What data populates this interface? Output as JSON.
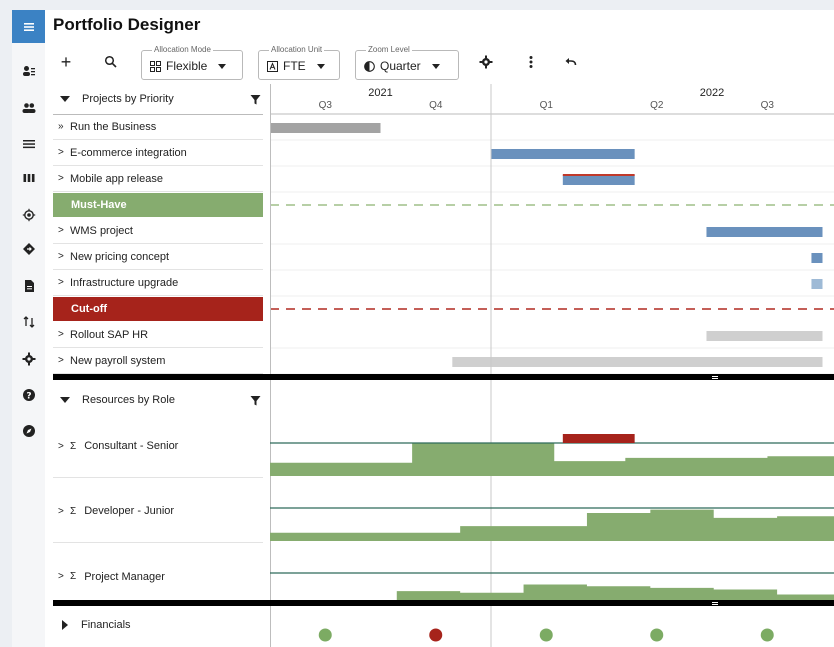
{
  "app": {
    "title": "Portfolio Designer"
  },
  "nav": {
    "icons": [
      "menu-icon",
      "person-list-icon",
      "people-icon",
      "list-icon",
      "columns-icon",
      "target-icon",
      "diamond-icon",
      "document-icon",
      "sort-icon",
      "gear-icon",
      "help-icon",
      "compass-icon"
    ]
  },
  "toolbar": {
    "add": "+",
    "search": "search-icon",
    "allocation_mode": {
      "legend": "Allocation Mode",
      "value": "Flexible"
    },
    "allocation_unit": {
      "legend": "Allocation Unit",
      "value": "FTE"
    },
    "zoom_level": {
      "legend": "Zoom Level",
      "value": "Quarter"
    }
  },
  "timeline": {
    "years": [
      "2021",
      "2022"
    ],
    "quarters": [
      "Q3",
      "Q4",
      "Q1",
      "Q2",
      "Q3"
    ]
  },
  "projects": {
    "header": "Projects by Priority",
    "items": [
      {
        "label": "Run the Business",
        "chevron": "»",
        "bar": {
          "start": 0.0,
          "end": 1.0,
          "color": "#a3a3a3"
        }
      },
      {
        "label": "E-commerce integration",
        "chevron": ">",
        "bar": {
          "start": 2.0,
          "end": 3.3,
          "color": "#6a91bd"
        }
      },
      {
        "label": "Mobile app release",
        "chevron": ">",
        "bar": {
          "start": 2.65,
          "end": 3.3,
          "color": "#6a91bd",
          "top_line": "#c0392b"
        }
      },
      {
        "label": "WMS project",
        "chevron": ">",
        "bar": {
          "start": 3.95,
          "end": 5.0,
          "color": "#6a91bd"
        }
      },
      {
        "label": "New pricing concept",
        "chevron": ">",
        "bar": {
          "start": 4.9,
          "end": 5.0,
          "color": "#6a91bd"
        }
      },
      {
        "label": "Infrastructure upgrade",
        "chevron": ">",
        "bar": {
          "start": 4.9,
          "end": 5.0,
          "color": "#9ebad6"
        }
      },
      {
        "label": "Rollout SAP HR",
        "chevron": ">",
        "bar": {
          "start": 3.95,
          "end": 5.0,
          "color": "#cfcfcf"
        }
      },
      {
        "label": "New payroll system",
        "chevron": ">",
        "bar": {
          "start": 1.65,
          "end": 5.0,
          "color": "#cfcfcf"
        }
      }
    ],
    "bands": [
      {
        "label": "Must-Have",
        "color": "#86ac6f",
        "line_color": "#9fbf88"
      },
      {
        "label": "Cut-off",
        "color": "#a6231b",
        "line_color": "#b02a20"
      }
    ]
  },
  "resources": {
    "header": "Resources by Role",
    "items": [
      {
        "label": "Consultant - Senior",
        "levels": [
          0.4,
          0.4,
          1.0,
          1.0,
          0.45,
          0.55,
          0.55,
          0.6
        ],
        "over": {
          "start": 2.65,
          "end": 3.3
        }
      },
      {
        "label": "Developer - Junior",
        "levels": [
          0.25,
          0.25,
          0.25,
          0.45,
          0.45,
          0.85,
          0.95,
          0.7,
          0.75
        ]
      },
      {
        "label": "Project Manager",
        "levels": [
          0.15,
          0.15,
          0.45,
          0.4,
          0.65,
          0.6,
          0.55,
          0.5,
          0.35
        ]
      }
    ]
  },
  "financials": {
    "label": "Financials",
    "dots": [
      {
        "pos": 0.5,
        "color": "#7cab63"
      },
      {
        "pos": 1.5,
        "color": "#a6231b"
      },
      {
        "pos": 2.5,
        "color": "#7cab63"
      },
      {
        "pos": 3.5,
        "color": "#7cab63"
      },
      {
        "pos": 4.5,
        "color": "#7cab63"
      }
    ]
  },
  "colors": {
    "accent": "#3b82c4",
    "capacity": "#86ac6f",
    "capacity_line": "#2f6b5a",
    "over": "#a6231b"
  }
}
